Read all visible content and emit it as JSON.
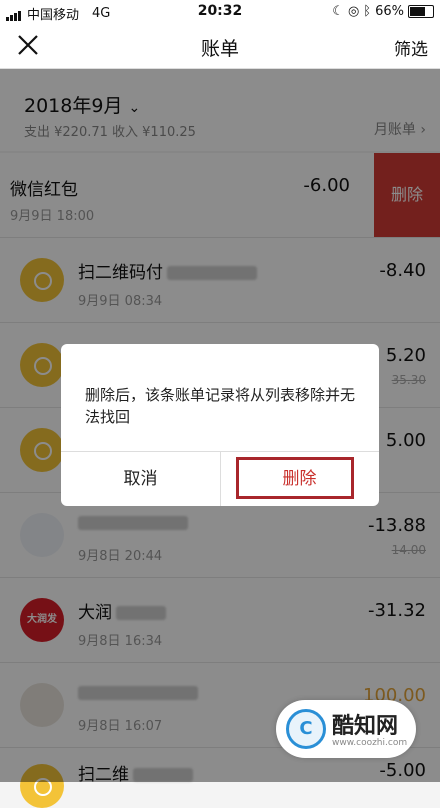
{
  "status": {
    "carrier": "中国移动",
    "network": "4G",
    "time": "20:32",
    "battery": "66%"
  },
  "nav": {
    "title": "账单",
    "filter": "筛选"
  },
  "month": {
    "label": "2018年9月",
    "summary": "支出 ¥220.71 收入 ¥110.25",
    "monthly_bill": "月账单"
  },
  "rows": [
    {
      "name": "微信红包",
      "date": "9月9日 18:00",
      "amount": "-6.00",
      "delete": "删除"
    },
    {
      "name": "扫二维码付",
      "date": "9月9日 08:34",
      "amount": "-8.40"
    },
    {
      "name": "",
      "date": "",
      "amount": "5.20",
      "sub": "35.30"
    },
    {
      "name": "",
      "date": "",
      "amount": "5.00"
    },
    {
      "name": "",
      "date": "9月8日 20:44",
      "amount": "-13.88",
      "sub": "14.00"
    },
    {
      "name": "大润",
      "date": "9月8日 16:34",
      "amount": "-31.32",
      "logo": "大润发"
    },
    {
      "name": "",
      "date": "9月8日 16:07",
      "amount": "100.00"
    },
    {
      "name": "扫二维",
      "date": "",
      "amount": "-5.00"
    }
  ],
  "dialog": {
    "message": "删除后，该条账单记录将从列表移除并无法找回",
    "cancel": "取消",
    "confirm": "删除"
  },
  "watermark": {
    "title": "酷知网",
    "url": "www.coozhi.com",
    "mark": "C"
  },
  "colors": {
    "accent_red": "#c9302c",
    "delete_bg": "#d23b35",
    "gold": "#f3c338"
  }
}
